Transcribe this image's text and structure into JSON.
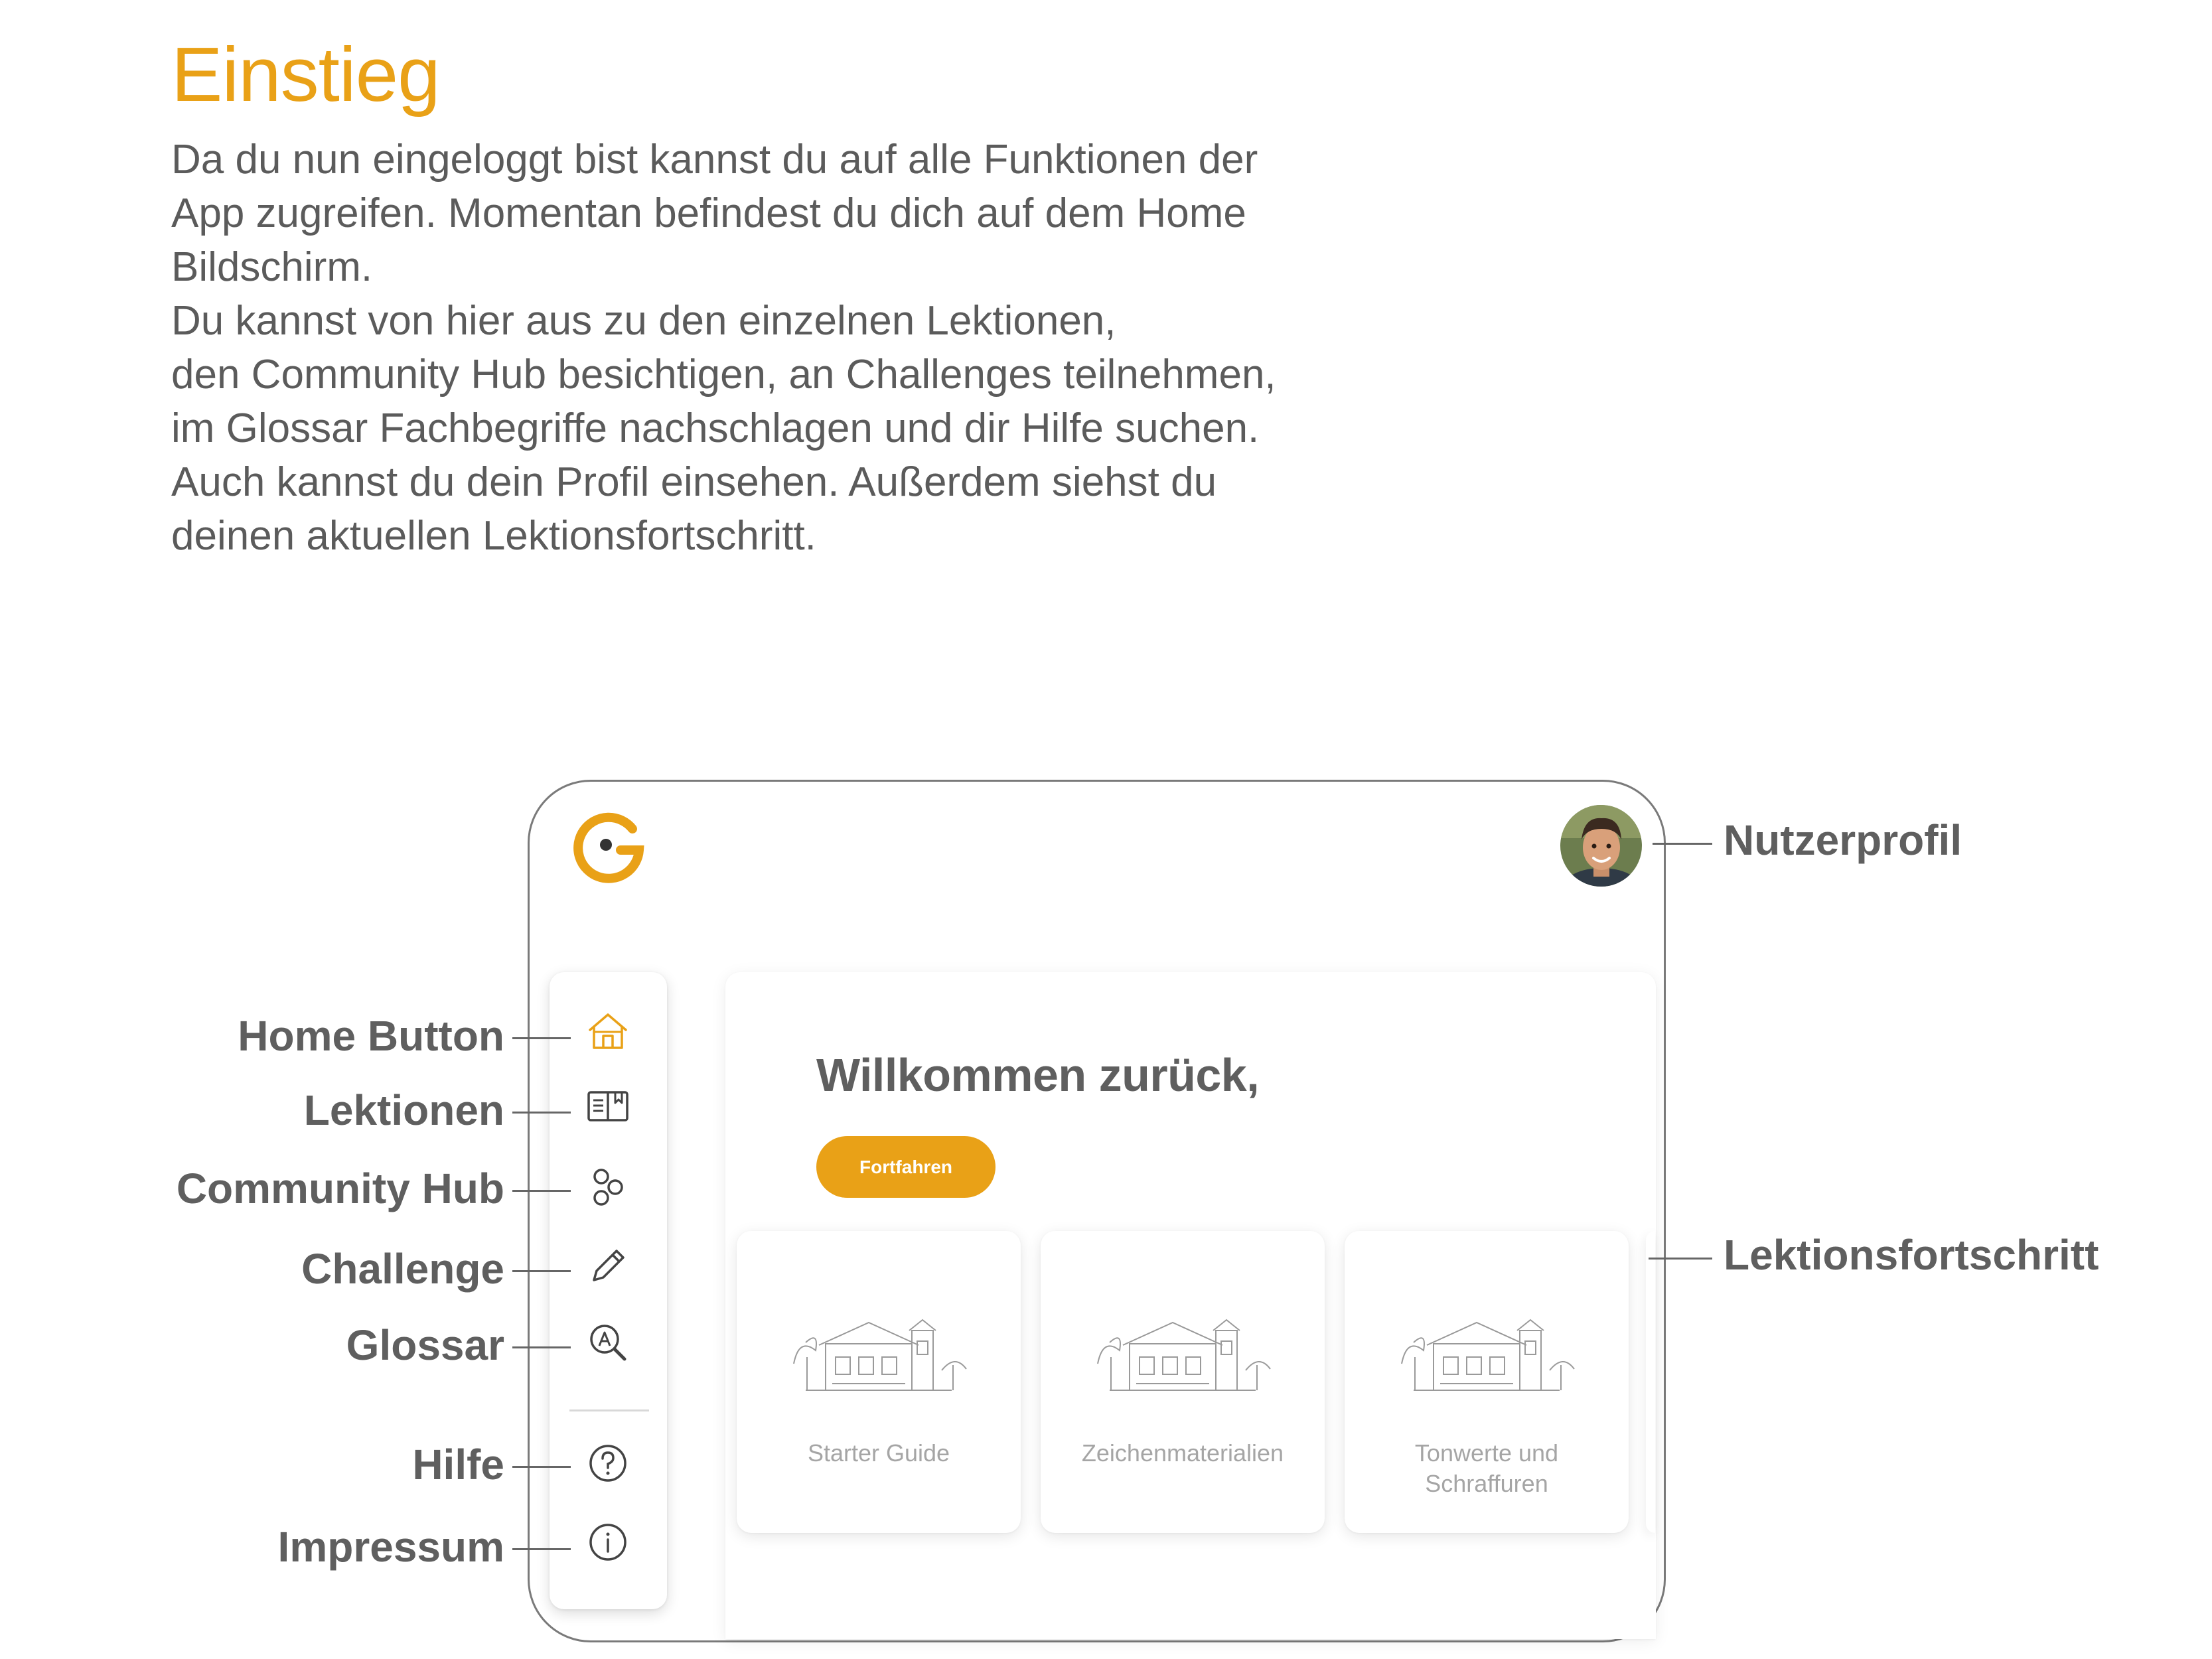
{
  "title": "Einstieg",
  "intro_lines": [
    "Da du nun eingeloggt bist kannst du auf alle Funktionen der",
    "App zugreifen. Momentan befindest du dich auf dem Home",
    "Bildschirm.",
    "Du kannst von hier aus zu den einzelnen Lektionen,",
    "den Community Hub besichtigen, an Challenges teilnehmen,",
    "im Glossar Fachbegriffe nachschlagen und dir Hilfe suchen.",
    "Auch kannst du dein Profil einsehen. Außerdem siehst du",
    "deinen aktuellen Lektionsfortschritt."
  ],
  "colors": {
    "accent": "#E9A117",
    "text": "#5b5b5b",
    "muted": "#a5a5a5"
  },
  "app": {
    "logo_icon": "brand-g-logo-icon",
    "avatar_icon": "user-avatar",
    "welcome": "Willkommen zurück,",
    "continue_label": "Fortfahren",
    "sidebar": [
      {
        "icon": "home-icon",
        "active": true
      },
      {
        "icon": "lessons-book-icon",
        "active": false
      },
      {
        "icon": "community-hub-icon",
        "active": false
      },
      {
        "icon": "pencil-icon",
        "active": false
      },
      {
        "icon": "glossary-search-icon",
        "active": false
      },
      {
        "icon": "help-question-icon",
        "active": false
      },
      {
        "icon": "info-icon",
        "active": false
      }
    ],
    "lessons": [
      {
        "label": "Starter Guide"
      },
      {
        "label": "Zeichenmaterialien"
      },
      {
        "label": "Tonwerte und\nSchraffuren"
      }
    ]
  },
  "annotations": {
    "home": "Home Button",
    "lessons": "Lektionen",
    "community": "Community Hub",
    "challenge": "Challenge",
    "glossary": "Glossar",
    "help": "Hilfe",
    "imprint": "Impressum",
    "profile": "Nutzerprofil",
    "progress": "Lektionsfortschritt"
  }
}
